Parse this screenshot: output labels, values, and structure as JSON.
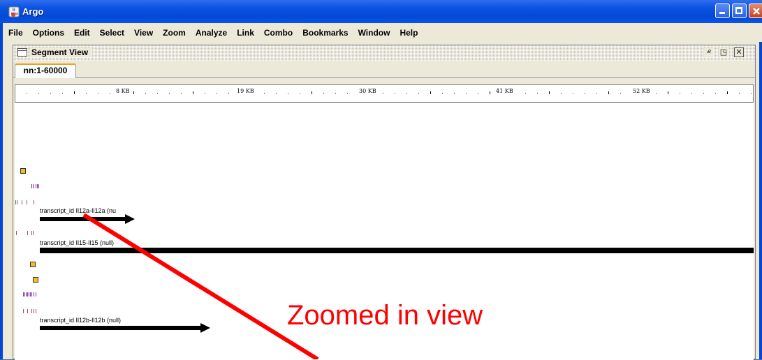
{
  "window": {
    "title": "Argo",
    "colors": {
      "titlebar": "#0447d6",
      "menu_bg": "#ece9d8"
    }
  },
  "menu": {
    "items": [
      "File",
      "Options",
      "Edit",
      "Select",
      "View",
      "Zoom",
      "Analyze",
      "Link",
      "Combo",
      "Bookmarks",
      "Window",
      "Help"
    ]
  },
  "segment_view": {
    "title": "Segment View",
    "tab": "nn:1-60000",
    "ruler": {
      "labels": [
        "8 KB",
        "19 KB",
        "30 KB",
        "41 KB",
        "52 KB"
      ]
    },
    "transcripts": [
      {
        "label": "transcript_id Il12a-Il12a (nu"
      },
      {
        "label": "transcript_id Il15-Il15 (null)"
      },
      {
        "label": "transcript_id Il12b-Il12b (null)"
      }
    ],
    "colors": {
      "feature_box": "#f2bf1d",
      "purple_marks": "#7b2fa8",
      "track_line": "#000000"
    }
  },
  "annotation": {
    "text": "Zoomed in view",
    "color": "#ff0000"
  }
}
